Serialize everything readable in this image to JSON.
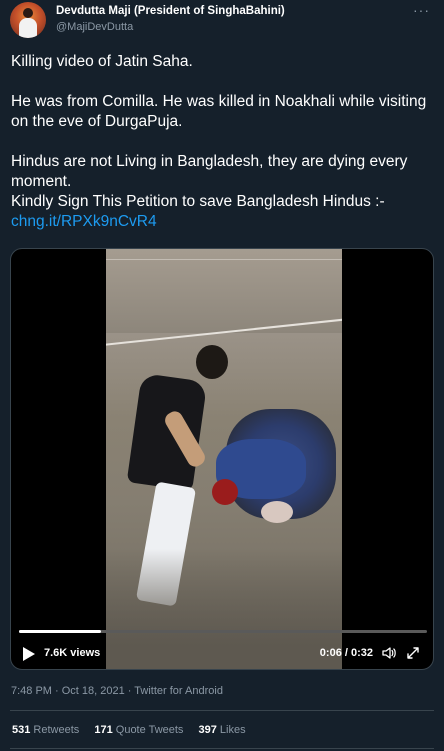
{
  "author": {
    "name": "Devdutta Maji (President of SinghaBahini)",
    "handle": "@MajiDevDutta"
  },
  "tweet": {
    "line1": "Killing video of Jatin Saha.",
    "line2": "He was from Comilla. He was killed in Noakhali while visiting on the eve of DurgaPuja.",
    "line3": "Hindus are not Living in Bangladesh, they are dying every moment.",
    "line4": "Kindly Sign This Petition to save Bangladesh Hindus :-",
    "link": "chng.it/RPXk9nCvR4"
  },
  "video": {
    "views": "7.6K views",
    "time": "0:06 / 0:32",
    "progress": 0.2,
    "icons": [
      "play-icon",
      "volume-icon",
      "fullscreen-icon"
    ]
  },
  "meta": "7:48 PM · Oct 18, 2021 · Twitter for Android",
  "stats": {
    "retweets_count": "531",
    "retweets_label": "Retweets",
    "quotes_count": "171",
    "quotes_label": "Quote Tweets",
    "likes_count": "397",
    "likes_label": "Likes"
  },
  "colors": {
    "background": "#15202b",
    "link": "#1d9bf0",
    "secondary_text": "#8b98a5"
  }
}
